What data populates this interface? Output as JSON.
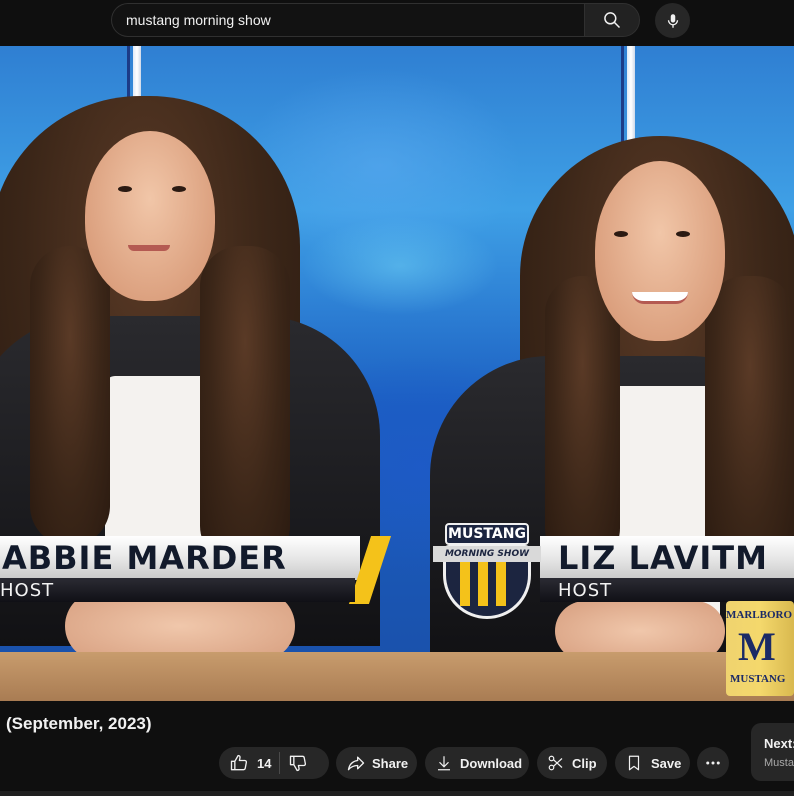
{
  "search": {
    "query": "mustang morning show"
  },
  "video": {
    "lower_thirds": [
      {
        "name": "ABBIE MARDER",
        "role": "HOST"
      },
      {
        "name": "LIZ LAVITM",
        "role": "HOST"
      }
    ],
    "logo": {
      "top": "MUSTANG",
      "band": "MORNING SHOW"
    },
    "mug": {
      "top": "MARLBORO H",
      "letter": "M",
      "bottom": "MUSTANG"
    }
  },
  "title_text": "(September, 2023)",
  "actions": {
    "like_count": "14",
    "share_label": "Share",
    "download_label": "Download",
    "clip_label": "Clip",
    "save_label": "Save"
  },
  "next": {
    "label": "Next:",
    "sub": "Musta"
  },
  "colors": {
    "background": "#0f0f0f",
    "pill": "#272727",
    "gold": "#f4c21a",
    "navy": "#1c2540"
  }
}
